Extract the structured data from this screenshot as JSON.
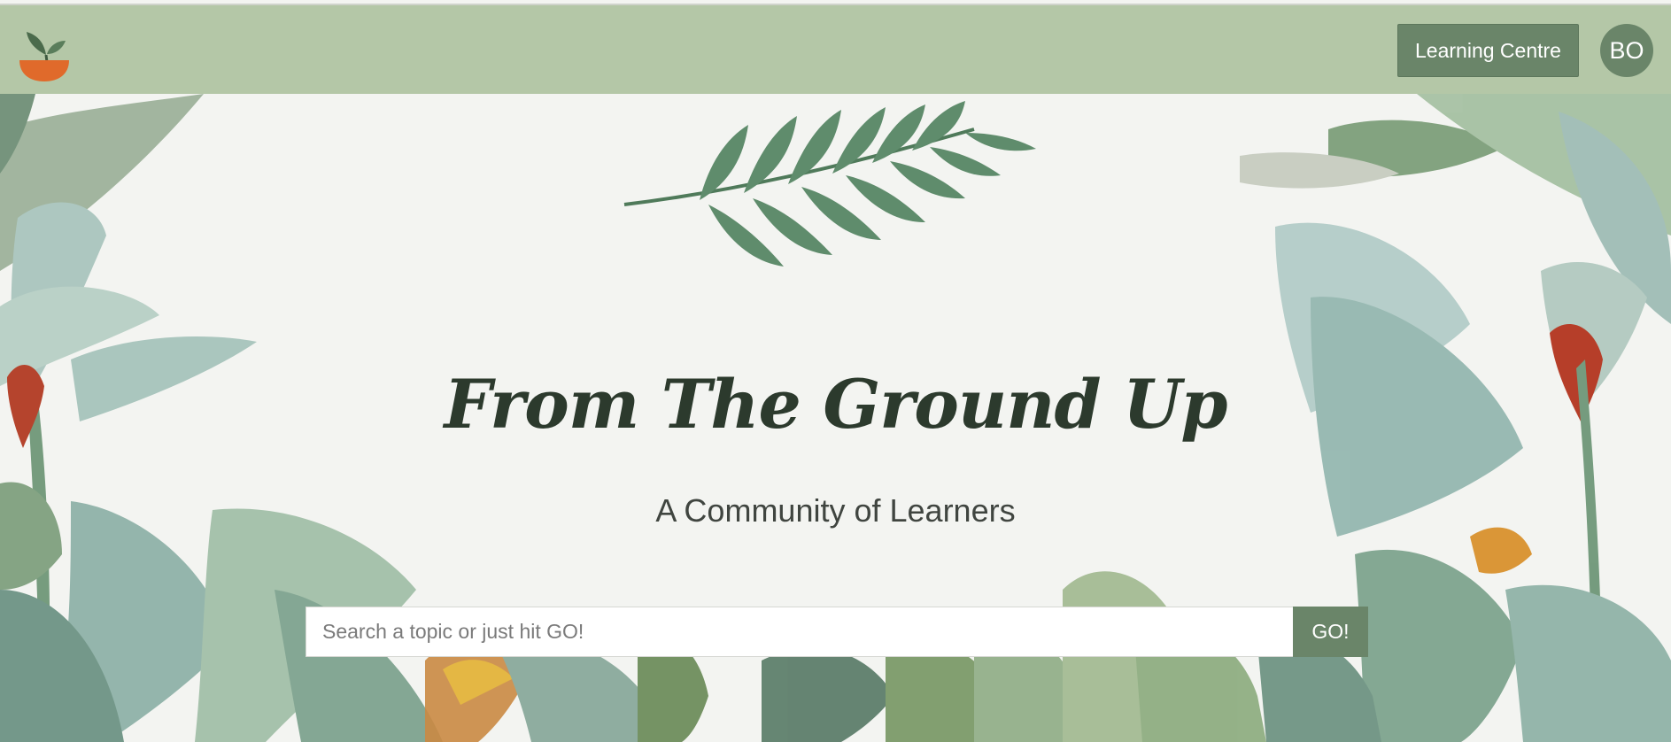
{
  "header": {
    "logo_icon": "bowl-sprout-logo-icon",
    "learning_centre_label": "Learning Centre",
    "avatar_initials": "BO"
  },
  "hero": {
    "title": "From The Ground Up",
    "subtitle": "A Community of Learners",
    "decor_icon": "fern-leaf-icon"
  },
  "search": {
    "placeholder": "Search a topic or just hit GO!",
    "value": "",
    "go_label": "GO!"
  },
  "colors": {
    "navbar": "#b4c7a7",
    "button": "#6a8569",
    "background": "#f3f4f1",
    "title": "#2c3a2d",
    "logo_bowl": "#e06a2b",
    "leaf": "#4f7a5a"
  }
}
